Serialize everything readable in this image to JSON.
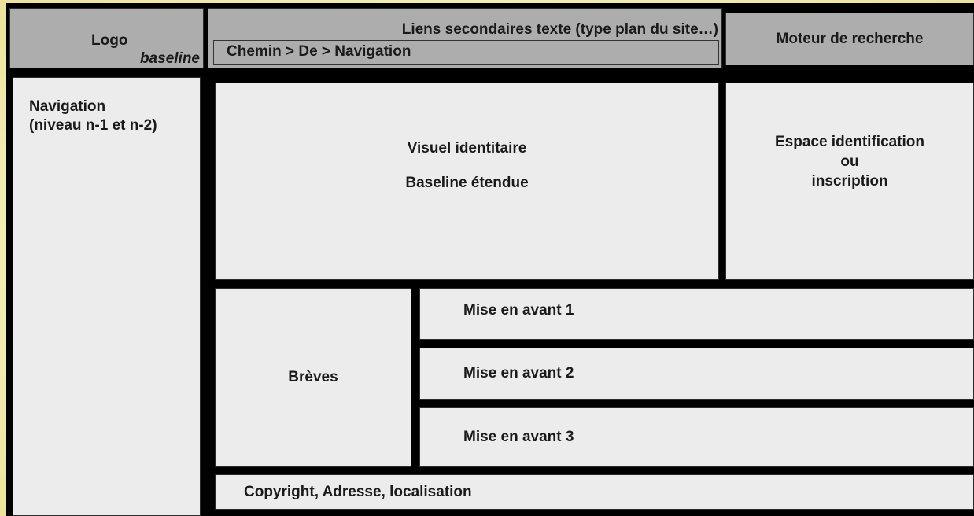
{
  "header": {
    "logo": "Logo",
    "baseline": "baseline",
    "secondary_links": "Liens secondaires texte (type plan du site…)",
    "breadcrumb": {
      "item1": "Chemin",
      "sep1": " > ",
      "item2": "De",
      "sep2": " > ",
      "item3": "Navigation"
    },
    "search": "Moteur de recherche"
  },
  "sidebar": {
    "title": "Navigation",
    "subtitle": "(niveau n-1 et n-2)"
  },
  "main": {
    "visual": {
      "line1": "Visuel identitaire",
      "line2": "Baseline étendue"
    },
    "login": {
      "line1": "Espace identification",
      "line2": "ou",
      "line3": "inscription"
    },
    "news": "Brèves",
    "featured": [
      "Mise en avant 1",
      "Mise en avant 2",
      "Mise en avant 3"
    ],
    "footer": "Copyright, Adresse, localisation"
  },
  "colors": {
    "background": "#f1ebb0",
    "frame": "#000000",
    "header_boxes": "#adadad",
    "content_boxes": "#ececec"
  }
}
